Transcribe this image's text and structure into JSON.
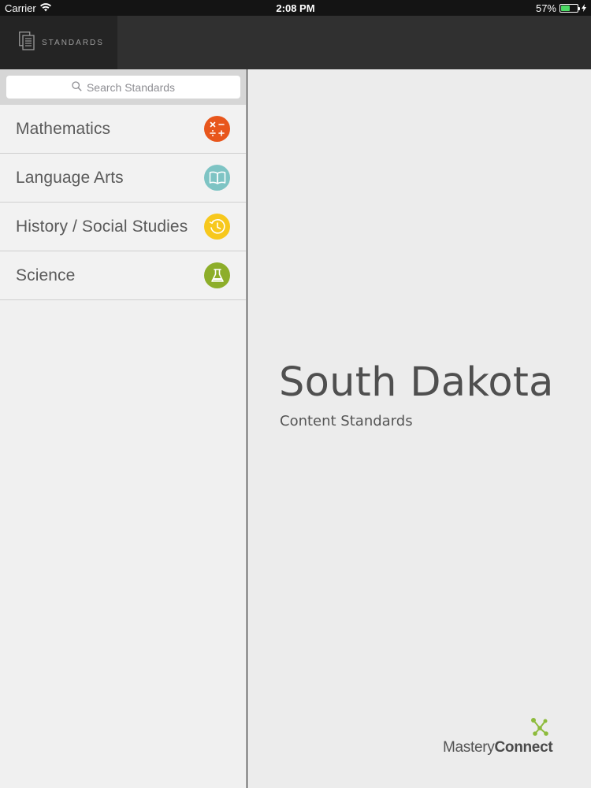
{
  "status_bar": {
    "carrier": "Carrier",
    "time": "2:08 PM",
    "battery_percent": "57%",
    "battery_level": 0.57
  },
  "nav": {
    "tab_label": "STANDARDS",
    "tab_icon": "document-stack-icon"
  },
  "search": {
    "placeholder": "Search Standards"
  },
  "subjects": [
    {
      "label": "Mathematics",
      "icon": "math-operators-icon",
      "color": "#e8561c"
    },
    {
      "label": "Language Arts",
      "icon": "open-book-icon",
      "color": "#7ec4c4"
    },
    {
      "label": "History / Social Studies",
      "icon": "history-clock-icon",
      "color": "#f7c81d"
    },
    {
      "label": "Science",
      "icon": "flask-icon",
      "color": "#8dae2a"
    }
  ],
  "main": {
    "title": "South Dakota",
    "subtitle": "Content Standards"
  },
  "brand": {
    "name_light": "Mastery",
    "name_bold": "Connect",
    "accent_color": "#8dbb3c"
  }
}
